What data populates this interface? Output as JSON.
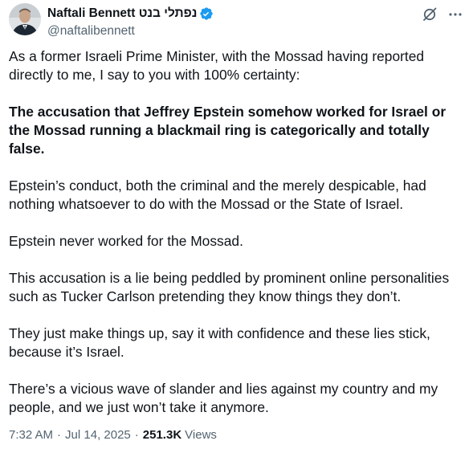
{
  "author": {
    "display_name": "Naftali Bennett נפתלי בנט",
    "handle": "@naftalibennett",
    "verified": true,
    "avatar": "avatar-photo"
  },
  "icons": {
    "verified": "verified-badge-icon",
    "grok": "grok-icon",
    "more": "more-options-icon"
  },
  "colors": {
    "verified_badge": "#1d9bf0",
    "text_primary": "#0f1419",
    "text_secondary": "#536471"
  },
  "tweet": {
    "paragraphs": [
      "As a former Israeli Prime Minister, with the Mossad having reported directly to me, I say to you with 100% certainty:",
      "The accusation that Jeffrey Epstein somehow worked for Israel or the Mossad running a blackmail ring is categorically and totally false.",
      "Epstein’s conduct, both the criminal and the merely despicable, had nothing whatsoever to do with the Mossad or the State of Israel.",
      "Epstein never worked for the Mossad.",
      "This accusation is a lie being peddled by prominent online personalities such as Tucker Carlson pretending they know things they don’t.",
      "They just make things up, say it with confidence and these lies stick, because it’s Israel.",
      "There’s a vicious wave of slander and lies against my country and my people, and we just won’t take it anymore."
    ]
  },
  "meta": {
    "time": "7:32 AM",
    "separator": "·",
    "date": "Jul 14, 2025",
    "views_count": "251.3K",
    "views_label": "Views"
  }
}
